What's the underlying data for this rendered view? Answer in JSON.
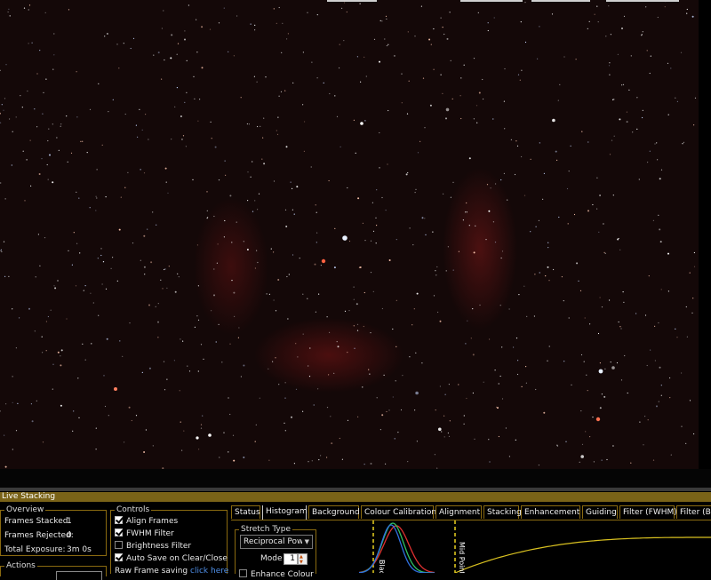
{
  "panel_title": "Live Stacking",
  "overview": {
    "title": "Overview",
    "frames_stacked_label": "Frames Stacked:",
    "frames_stacked_value": "1",
    "frames_rejected_label": "Frames Rejected:",
    "frames_rejected_value": "0",
    "total_exposure_label": "Total Exposure:",
    "total_exposure_value": "3m 0s"
  },
  "actions": {
    "title": "Actions"
  },
  "controls": {
    "title": "Controls",
    "align_frames": {
      "label": "Align Frames",
      "checked": true
    },
    "fwhm_filter": {
      "label": "FWHM Filter",
      "checked": true
    },
    "brightness_filter": {
      "label": "Brightness Filter",
      "checked": false
    },
    "auto_save": {
      "label": "Auto Save on Clear/Close",
      "checked": true
    },
    "raw_saving_label": "Raw Frame saving",
    "raw_saving_link": "click here"
  },
  "tabs": [
    "Status",
    "Histogram",
    "Background",
    "Colour Calibration",
    "Alignment",
    "Stacking",
    "Enhancement",
    "Guiding",
    "Filter (FWHM)",
    "Filter (Brightness)"
  ],
  "active_tab": "Histogram",
  "histogram": {
    "stretch_type_title": "Stretch Type",
    "stretch_type_value": "Reciprocal Power",
    "mode_label": "Mode",
    "mode_value": "1",
    "enhance_colour_label": "Enhance Colour",
    "black_marker_label": "Black",
    "mid_marker_label": "Mid Point",
    "colors": {
      "red": "#e03030",
      "green": "#30c060",
      "blue": "#3070e0",
      "curve": "#d8c020",
      "marker": "#e8d020"
    }
  },
  "colors": {
    "accent": "#8a6a10",
    "title_bar": "#7a6318"
  }
}
